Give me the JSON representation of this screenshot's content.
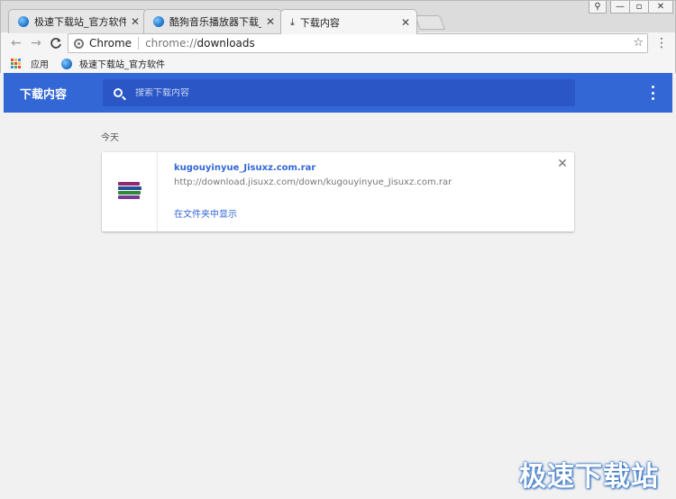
{
  "tabs": [
    {
      "title": "极速下载站_官方软件下载",
      "icon": "globe-icon",
      "active": false
    },
    {
      "title": "酷狗音乐播放器下载_酷狗",
      "icon": "globe-icon",
      "active": false
    },
    {
      "title": "下载内容",
      "icon": "download-icon",
      "active": true
    }
  ],
  "window_controls": {
    "user": "⚲",
    "minimize": "—",
    "maximize": "▫",
    "close": "✕"
  },
  "toolbar": {
    "back": "←",
    "forward": "→",
    "reload": "C",
    "omnibox_chip": "Chrome",
    "url_scheme": "chrome://",
    "url_rest": "downloads",
    "star": "☆",
    "menu": "⋮"
  },
  "bookmarks": {
    "apps_label": "应用",
    "apps_colors": [
      "#e8453c",
      "#f9bb2d",
      "#3c8cea",
      "#52a54d",
      "#e8453c",
      "#f9bb2d",
      "#3c8cea",
      "#52a54d",
      "#e8453c"
    ],
    "items": [
      {
        "label": "极速下载站_官方软件"
      }
    ]
  },
  "downloads_page": {
    "title": "下载内容",
    "search_placeholder": "搜索下载内容",
    "date_header": "今天",
    "items": [
      {
        "file_name": "kugouyinyue_Jisuxz.com.rar",
        "url": "http://download.jisuxz.com/down/kugouyinyue_Jisuxz.com.rar",
        "show_in_folder": "在文件夹中显示",
        "remove": "✕"
      }
    ]
  },
  "colors": {
    "header": "#3367d6",
    "search_bg": "#2a56c6",
    "link": "#3367d6",
    "page_bg": "#f1f1f1"
  },
  "watermark": "极速下载站"
}
